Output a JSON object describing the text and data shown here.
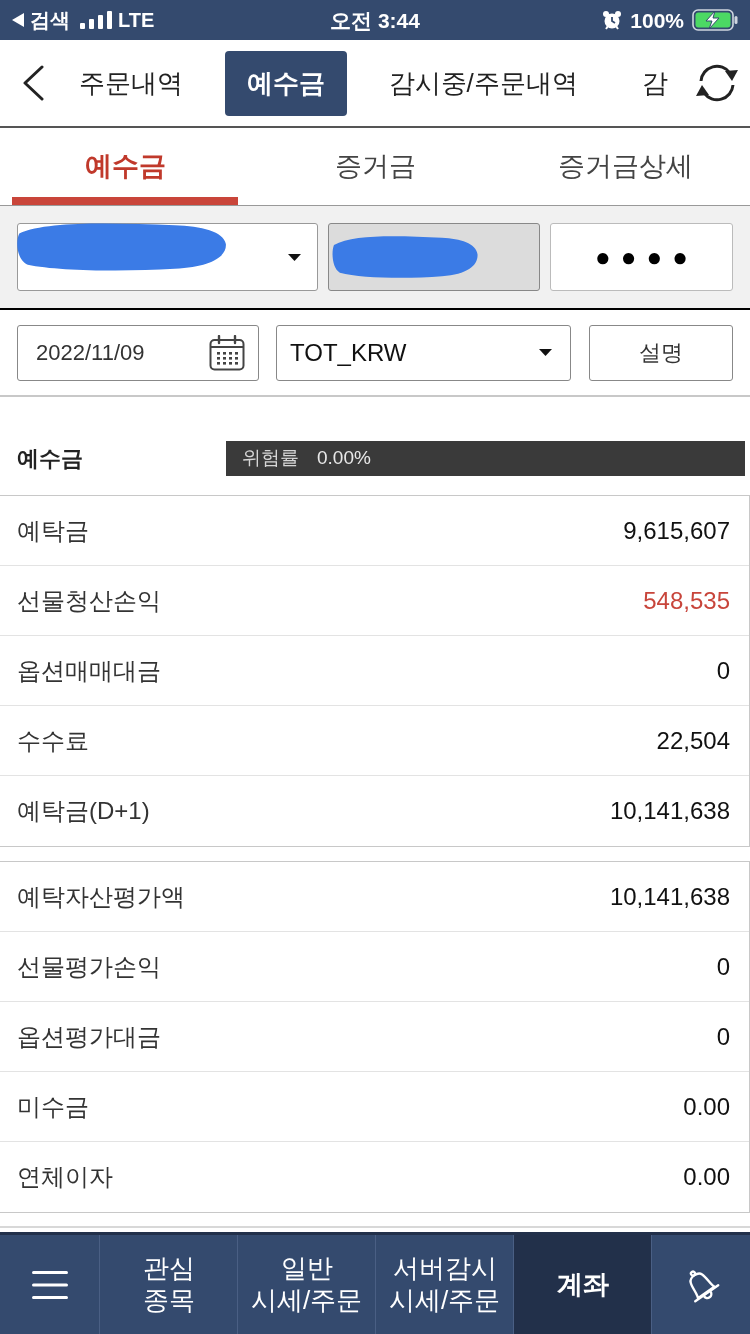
{
  "status_bar": {
    "back_label": "검색",
    "network": "LTE",
    "time": "오전 3:44",
    "battery": "100%"
  },
  "top_tabs": [
    {
      "label": "주문내역",
      "selected": false
    },
    {
      "label": "예수금",
      "selected": true
    },
    {
      "label": "감시중/주문내역",
      "selected": false
    },
    {
      "label": "감",
      "selected": false
    }
  ],
  "sub_tabs": [
    {
      "label": "예수금",
      "selected": true
    },
    {
      "label": "증거금",
      "selected": false
    },
    {
      "label": "증거금상세",
      "selected": false
    }
  ],
  "account": {
    "password": "●●●●"
  },
  "filters": {
    "date": "2022/11/09",
    "currency": "TOT_KRW",
    "explain_button": "설명"
  },
  "summary": {
    "title": "예수금",
    "risk_label": "위험률",
    "risk_value": "0.00%"
  },
  "groups": [
    {
      "rows": [
        {
          "label": "예탁금",
          "value": "9,615,607",
          "color": "#111111"
        },
        {
          "label": "선물청산손익",
          "value": "548,535",
          "color": "#c8453b"
        },
        {
          "label": "옵션매매대금",
          "value": "0",
          "color": "#111111"
        },
        {
          "label": "수수료",
          "value": "22,504",
          "color": "#111111"
        },
        {
          "label": "예탁금(D+1)",
          "value": "10,141,638",
          "color": "#111111"
        }
      ]
    },
    {
      "rows": [
        {
          "label": "예탁자산평가액",
          "value": "10,141,638",
          "color": "#111111"
        },
        {
          "label": "선물평가손익",
          "value": "0",
          "color": "#111111"
        },
        {
          "label": "옵션평가대금",
          "value": "0",
          "color": "#111111"
        },
        {
          "label": "미수금",
          "value": "0.00",
          "color": "#111111"
        },
        {
          "label": "연체이자",
          "value": "0.00",
          "color": "#111111"
        }
      ]
    }
  ],
  "bottom_nav": [
    {
      "kind": "menu",
      "selected": false
    },
    {
      "kind": "text",
      "lines": [
        "관심",
        "종목"
      ],
      "selected": false
    },
    {
      "kind": "text",
      "lines": [
        "일반",
        "시세/주문"
      ],
      "selected": false
    },
    {
      "kind": "text",
      "lines": [
        "서버감시",
        "시세/주문"
      ],
      "selected": false
    },
    {
      "kind": "text",
      "lines": [
        "계좌"
      ],
      "selected": true
    },
    {
      "kind": "bell",
      "selected": false
    }
  ]
}
